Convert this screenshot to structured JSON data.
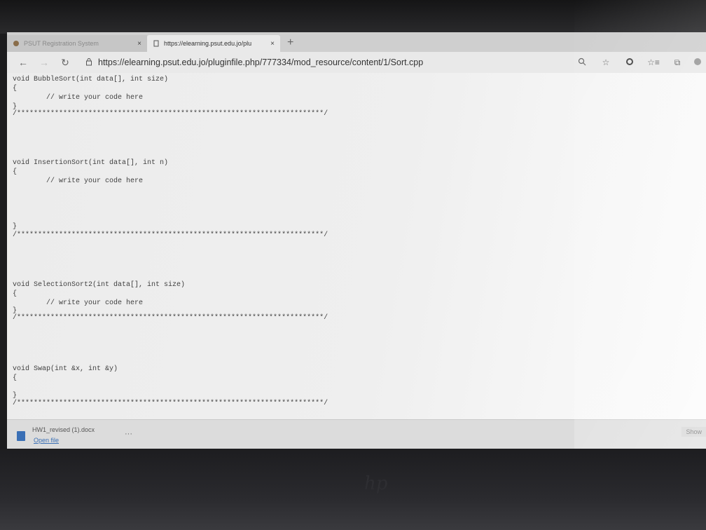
{
  "browser": {
    "tabs": [
      {
        "title": "PSUT Registration System",
        "close": "×"
      },
      {
        "title": "https://elearning.psut.edu.jo/plu",
        "close": "×"
      }
    ],
    "new_tab": "+",
    "address": {
      "url": "https://elearning.psut.edu.jo/pluginfile.php/777334/mod_resource/content/1/Sort.cpp"
    },
    "icons": {
      "back": "←",
      "forward": "→",
      "refresh": "↻",
      "lock": "🔒",
      "zoom": "🔍",
      "favorite": "☆",
      "circle": "○",
      "favorites_list": "☆≡",
      "collections": "⧉"
    }
  },
  "code": {
    "bubble_sig": "void BubbleSort(int data[], int size)",
    "bubble_open": "{",
    "bubble_comment": "        // write your code here",
    "bubble_close": "}",
    "sep1": "/*************************************************************************/",
    "insertion_sig": "void InsertionSort(int data[], int n)",
    "insertion_open": "{",
    "insertion_comment": "        // write your code here",
    "insertion_close": "}",
    "sep2": "/*************************************************************************/",
    "selection_sig": "void SelectionSort2(int data[], int size)",
    "selection_open": "{",
    "selection_comment": "        // write your code here",
    "selection_close": "}",
    "sep3": "/*************************************************************************/",
    "swap_sig": "void Swap(int &x, int &y)",
    "swap_open": "{",
    "swap_close": "}",
    "sep4": "/*************************************************************************/"
  },
  "download": {
    "filename": "HW1_revised (1).docx",
    "open_label": "Open file",
    "more": "···",
    "show_label": "Show"
  },
  "laptop": {
    "logo": "hp"
  }
}
